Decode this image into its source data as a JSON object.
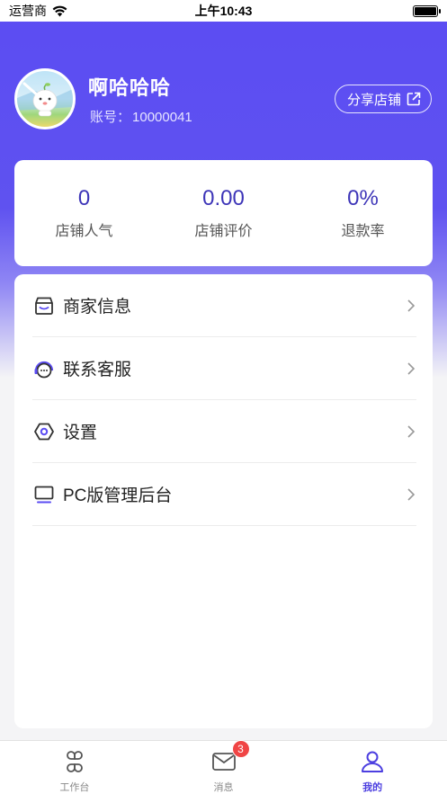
{
  "status_bar": {
    "carrier": "运营商",
    "time": "上午10:43"
  },
  "profile": {
    "name": "啊哈哈哈",
    "account_label": "账号：",
    "account_number": "10000041",
    "share_label": "分享店铺"
  },
  "stats": [
    {
      "value": "0",
      "label": "店铺人气"
    },
    {
      "value": "0.00",
      "label": "店铺评价"
    },
    {
      "value": "0%",
      "label": "退款率"
    }
  ],
  "menu": [
    {
      "label": "商家信息",
      "icon": "store-icon"
    },
    {
      "label": "联系客服",
      "icon": "customer-service-icon"
    },
    {
      "label": "设置",
      "icon": "settings-icon"
    },
    {
      "label": "PC版管理后台",
      "icon": "monitor-icon"
    }
  ],
  "tabs": [
    {
      "label": "工作台",
      "icon": "grid-icon"
    },
    {
      "label": "消息",
      "icon": "mail-icon",
      "badge": "3"
    },
    {
      "label": "我的",
      "icon": "user-icon",
      "active": true
    }
  ],
  "colors": {
    "accent": "#5b4cf3",
    "stat_value": "#3d35b8",
    "badge": "#f04545"
  }
}
